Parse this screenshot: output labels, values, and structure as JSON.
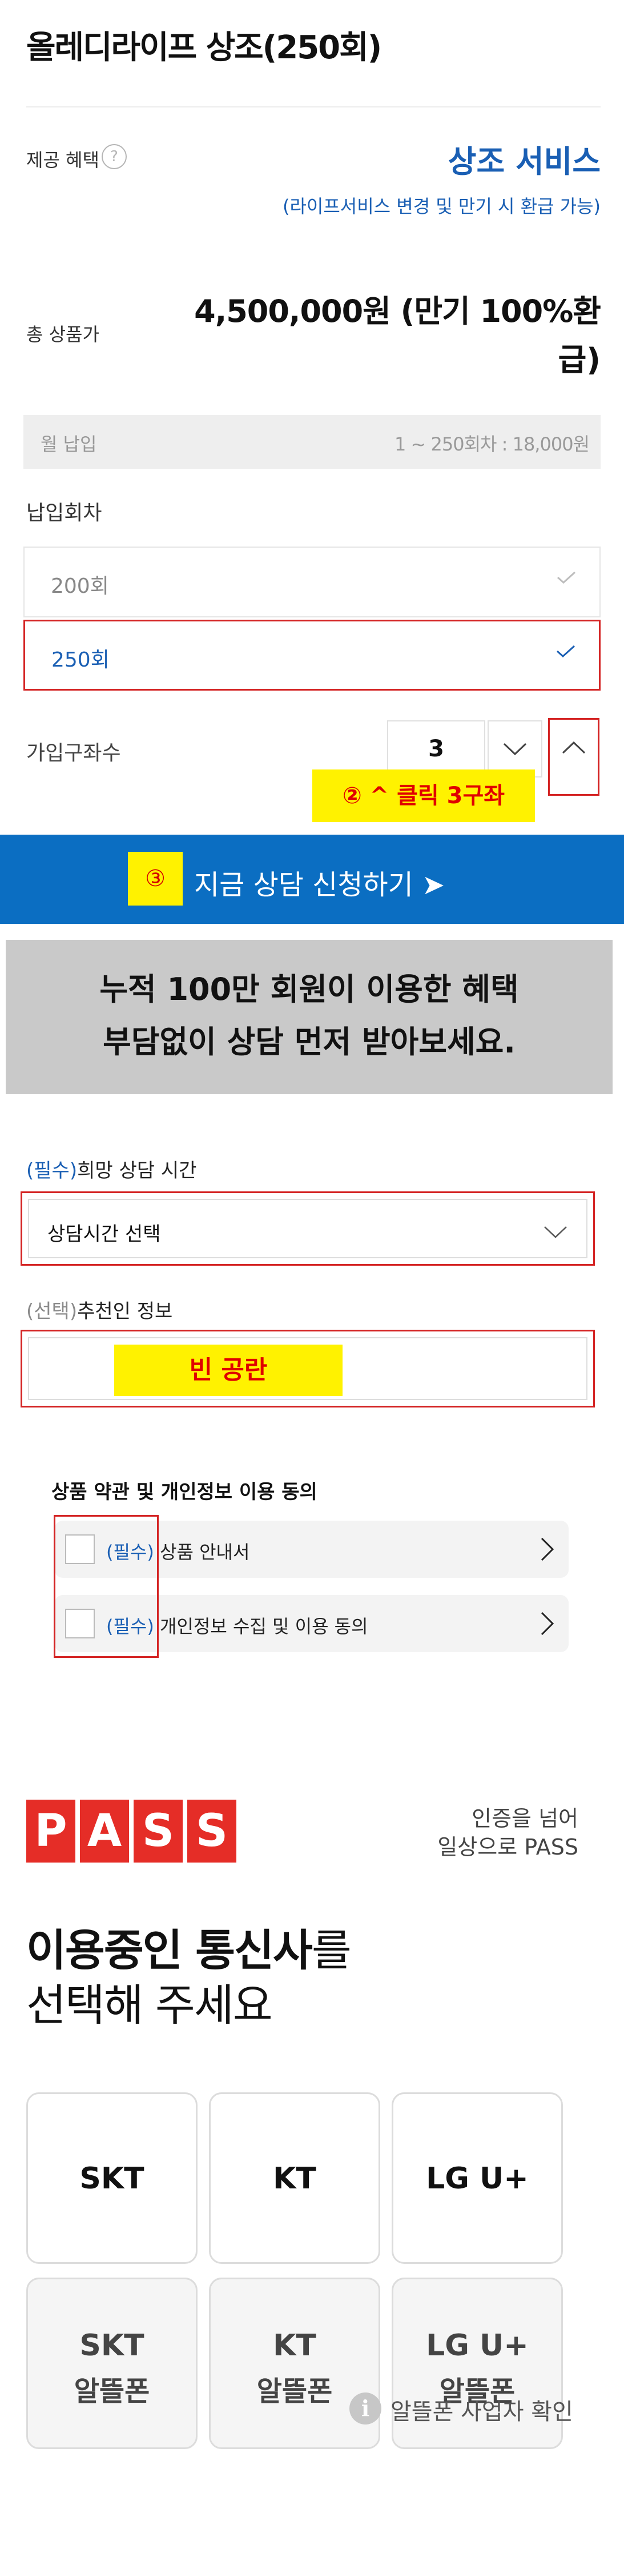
{
  "product": {
    "title": "올레디라이프 상조(250회)",
    "benefit_label": "제공 혜택",
    "benefit_help": "?",
    "benefit_value": "상조 서비스",
    "benefit_note": "(라이프서비스 변경 및 만기 시 환급 가능)",
    "total_label": "총 상품가",
    "total_value_line1": "4,500,000원 (만기 100%환",
    "total_value_line2": "급)",
    "monthly_label": "월 납입",
    "monthly_value": "1 ~ 250회차 : 18,000원"
  },
  "installments": {
    "label": "납입회차",
    "options": [
      {
        "label": "200회",
        "selected": false
      },
      {
        "label": "250회",
        "selected": true
      }
    ]
  },
  "accounts": {
    "label": "가입구좌수",
    "value": "3"
  },
  "annotations": {
    "step2": "② ^ 클릭 3구좌",
    "step3": "③",
    "blank": "빈 공란"
  },
  "cta": {
    "label": "지금 상담 신청하기 ➤"
  },
  "promo": {
    "line1": "누적 100만 회원이 이용한 혜택",
    "line2": "부담없이 상담 먼저 받아보세요."
  },
  "consult_time": {
    "required_tag": "(필수)",
    "label": "희망 상담 시간",
    "placeholder": "상담시간 선택"
  },
  "referrer": {
    "optional_tag": "(선택)",
    "label": "추천인 정보"
  },
  "terms": {
    "title": "상품 약관 및 개인정보 이용 동의",
    "items": [
      {
        "tag": "(필수)",
        "label": "상품 안내서"
      },
      {
        "tag": "(필수)",
        "label": "개인정보 수집 및 이용 동의"
      }
    ]
  },
  "pass": {
    "logo_letters": [
      "P",
      "A",
      "S",
      "S"
    ],
    "slogan_line1": "인증을 넘어",
    "slogan_line2": "일상으로 PASS",
    "heading_bold": "이용중인 통신사",
    "heading_rest": "를",
    "heading_line2": "선택해 주세요",
    "carriers": [
      {
        "name": "SKT",
        "sub": ""
      },
      {
        "name": "KT",
        "sub": ""
      },
      {
        "name": "LG U+",
        "sub": ""
      },
      {
        "name": "SKT",
        "sub": "알뜰폰"
      },
      {
        "name": "KT",
        "sub": "알뜰폰"
      },
      {
        "name": "LG U+",
        "sub": "알뜰폰"
      }
    ],
    "mvno_info_icon": "i",
    "mvno_info": "알뜰폰 사업자 확인"
  },
  "colors": {
    "brand_blue": "#0b6ec2",
    "annotation_yellow": "#fff200",
    "annotation_red": "#d42424",
    "pass_red": "#e52d27"
  }
}
